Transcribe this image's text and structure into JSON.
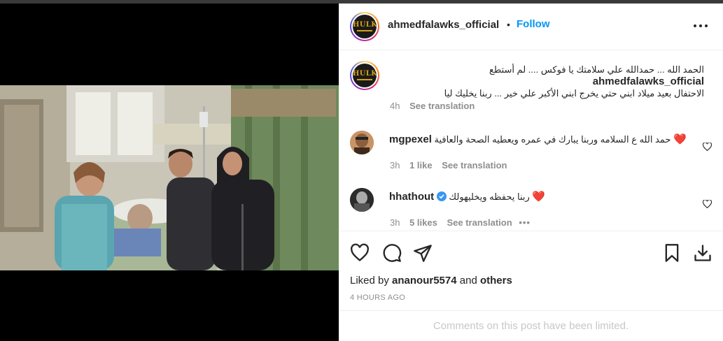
{
  "post": {
    "username": "ahmedfalawks_official",
    "separator": "•",
    "follow_label": "Follow",
    "avatar_text": "HULK"
  },
  "caption": {
    "username": "ahmedfalawks_official",
    "text_line1": "الحمد الله ... حمدالله علي سلامتك يا فوكس .... لم أستطع",
    "text_line2": "الاحتفال بعيد ميلاد ابني حتي يخرج ابني الأكبر علي خير ... ربنا يخليك ليا",
    "age": "4h",
    "see_translation": "See translation"
  },
  "comments": [
    {
      "username": "mgpexel",
      "text": "حمد الله ع السلامه وربنا يبارك في عمره ويعطيه الصحة والعافية",
      "emoji": "❤️",
      "age": "3h",
      "likes": "1 like",
      "see_translation": "See translation",
      "verified": false
    },
    {
      "username": "hhathout",
      "text": "ربنا يحفظه ويخليهولك",
      "emoji": "❤️",
      "age": "3h",
      "likes": "5 likes",
      "see_translation": "See translation",
      "more": "•••",
      "verified": true
    }
  ],
  "actions": [
    "like-icon",
    "comment-icon",
    "share-icon",
    "save-icon",
    "download-icon"
  ],
  "likes": {
    "prefix": "Liked by",
    "user": "ananour5574",
    "middle": "and",
    "others": "others"
  },
  "timestamp": "4 HOURS AGO",
  "limited_notice": "Comments on this post have been limited.",
  "colors": {
    "accent": "#0095f6",
    "verified": "#3897f0",
    "heart": "#ed4956",
    "muted": "#8e8e8e"
  }
}
